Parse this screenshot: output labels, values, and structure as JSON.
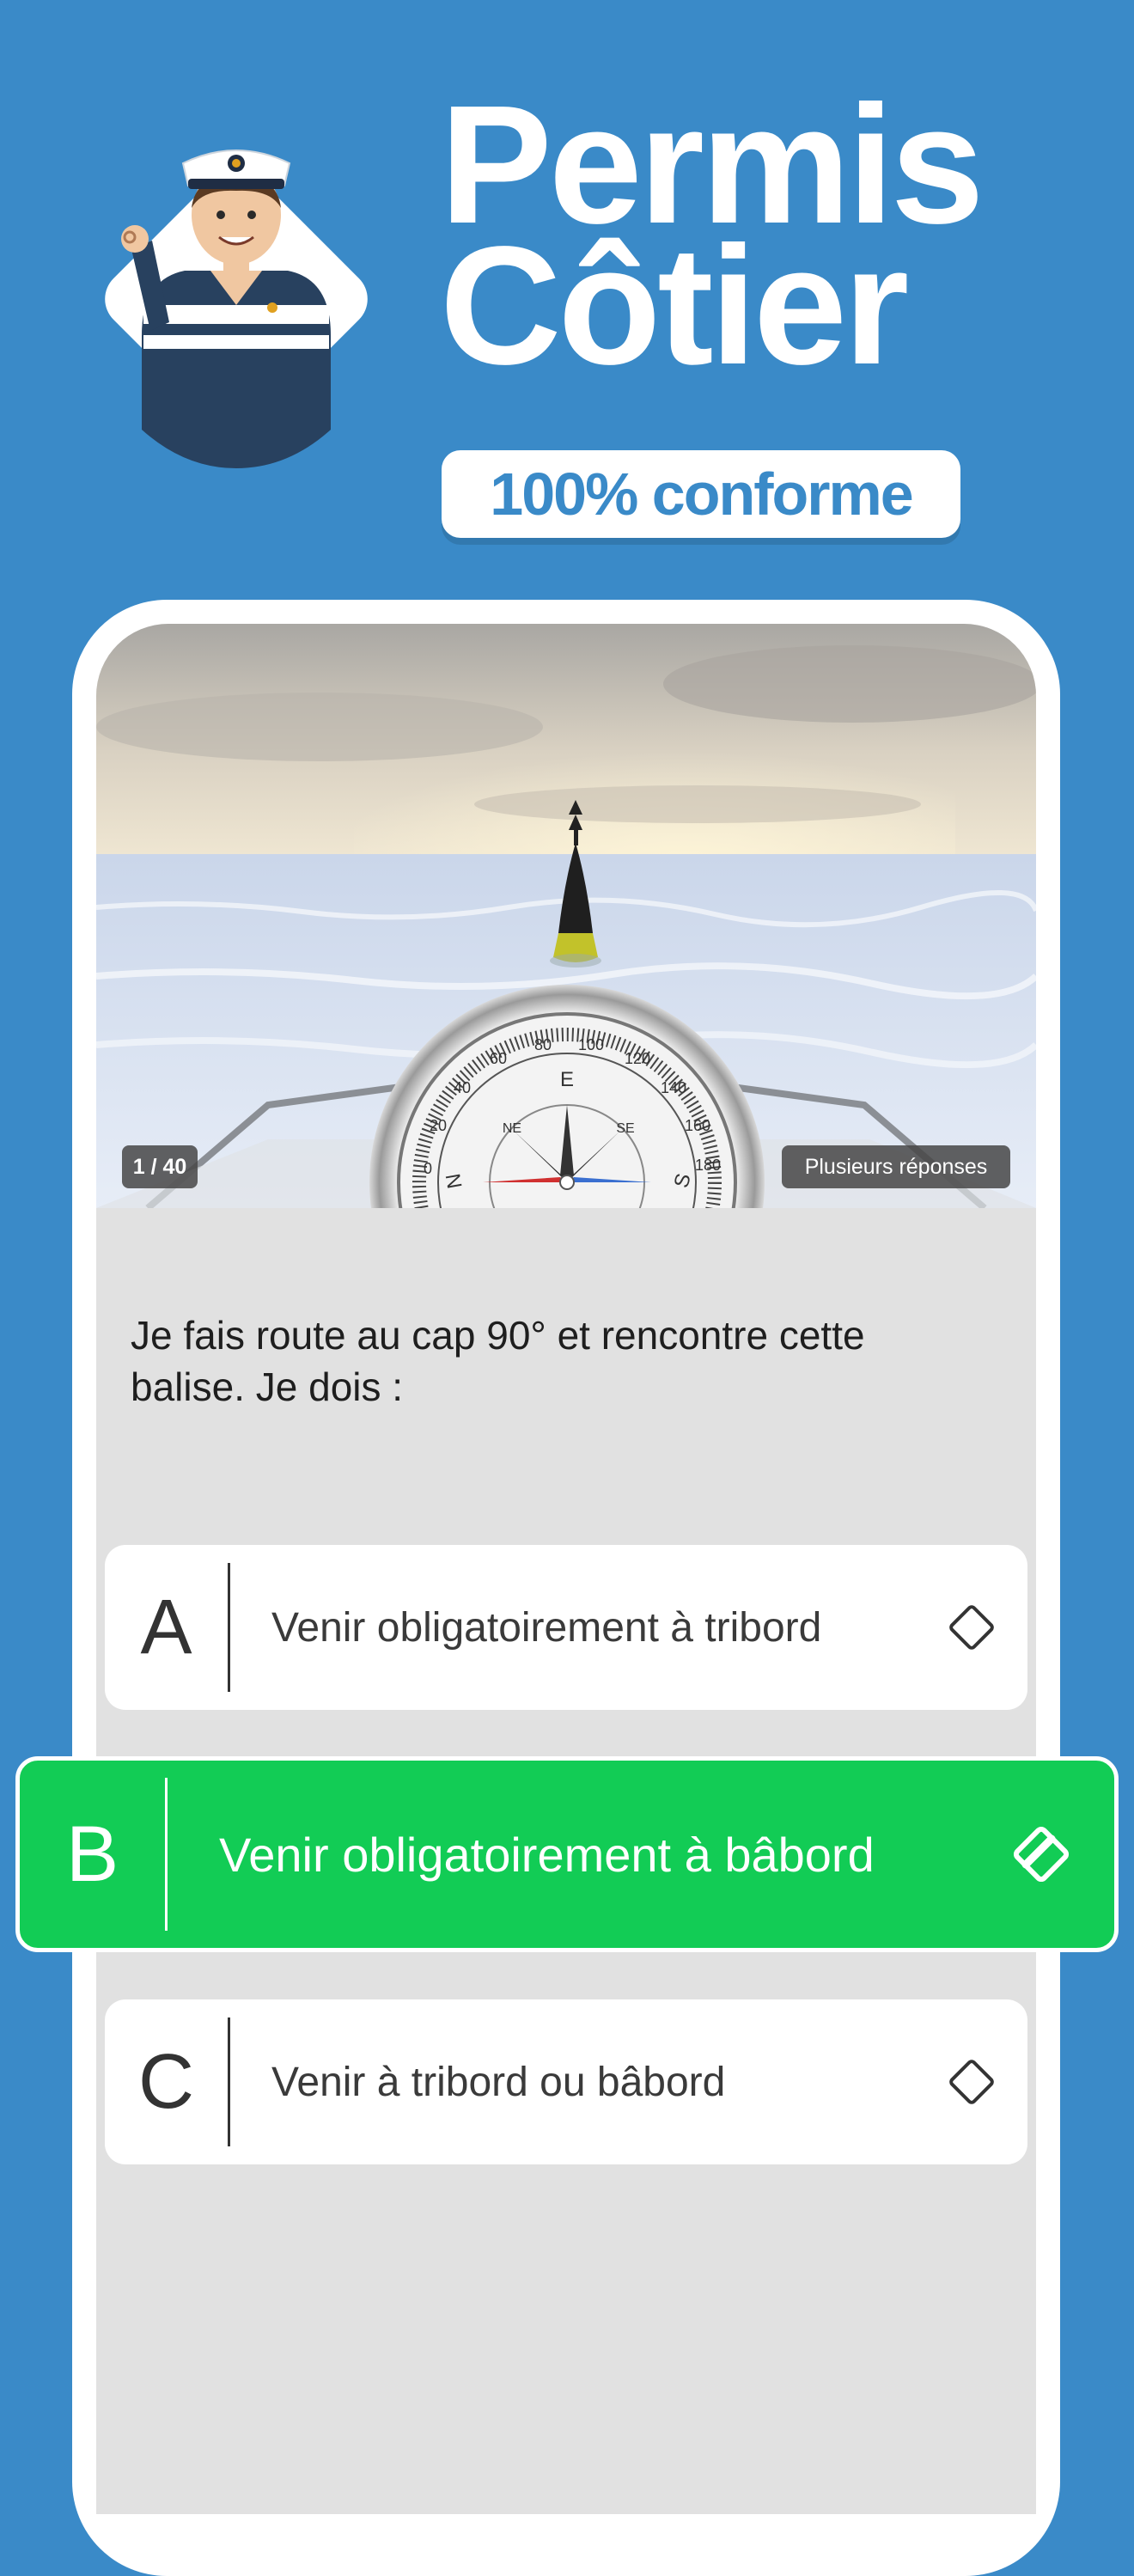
{
  "header": {
    "title_line1": "Permis",
    "title_line2": "Côtier",
    "badge": "100% conforme"
  },
  "quiz": {
    "counter": "1 / 40",
    "mode": "Plusieurs réponses",
    "question": "Je fais route au cap 90° et rencontre cette balise. Je dois :",
    "answers": [
      {
        "letter": "A",
        "text": "Venir obligatoirement à tribord",
        "selected": false,
        "icon": "diamond-icon"
      },
      {
        "letter": "B",
        "text": "Venir obligatoirement à bâbord",
        "selected": true,
        "icon": "diamond-check-icon"
      },
      {
        "letter": "C",
        "text": "Venir à tribord ou bâbord",
        "selected": false,
        "icon": "diamond-icon"
      }
    ],
    "compass_labels": [
      "E",
      "S",
      "N",
      "NE",
      "SE",
      "100",
      "120",
      "140",
      "160",
      "180",
      "80",
      "60",
      "40",
      "20",
      "0"
    ]
  },
  "colors": {
    "background": "#3a8ac8",
    "selected": "#12cc55",
    "panel": "#e1e1e1"
  }
}
